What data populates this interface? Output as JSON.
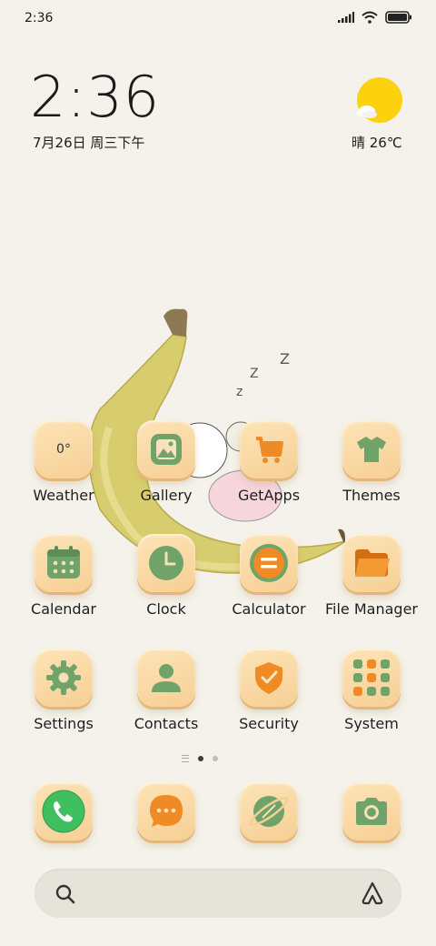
{
  "status_bar": {
    "time": "2:36",
    "icons": [
      "signal-icon",
      "wifi-icon",
      "battery-icon"
    ]
  },
  "clock_widget": {
    "time": "2:36",
    "date": "7月26日 周三下午"
  },
  "weather_widget": {
    "condition_temp": "晴 26℃",
    "icon": "sun-cloud-icon"
  },
  "apps_row1": [
    {
      "label": "Weather",
      "icon": "weather-icon",
      "badge": "0°"
    },
    {
      "label": "Gallery",
      "icon": "gallery-icon"
    },
    {
      "label": "GetApps",
      "icon": "cart-icon"
    },
    {
      "label": "Themes",
      "icon": "tshirt-icon"
    }
  ],
  "apps_row2": [
    {
      "label": "Calendar",
      "icon": "calendar-icon"
    },
    {
      "label": "Clock",
      "icon": "clock-icon"
    },
    {
      "label": "Calculator",
      "icon": "calculator-icon"
    },
    {
      "label": "File Manager",
      "icon": "folder-icon"
    }
  ],
  "apps_row3": [
    {
      "label": "Settings",
      "icon": "gear-icon"
    },
    {
      "label": "Contacts",
      "icon": "person-icon"
    },
    {
      "label": "Security",
      "icon": "shield-icon"
    },
    {
      "label": "System",
      "icon": "system-folder-icon"
    }
  ],
  "page_indicator": {
    "pages": 2,
    "current": 1
  },
  "dock": [
    {
      "icon": "phone-icon"
    },
    {
      "icon": "message-icon"
    },
    {
      "icon": "browser-icon"
    },
    {
      "icon": "camera-icon"
    }
  ],
  "search_bar": {
    "left_icon": "search-icon",
    "right_icon": "assistant-icon"
  },
  "colors": {
    "background": "#f4f2ea",
    "tile": "#f8d9a3",
    "green": "#6fa36a",
    "orange": "#f08a24"
  }
}
